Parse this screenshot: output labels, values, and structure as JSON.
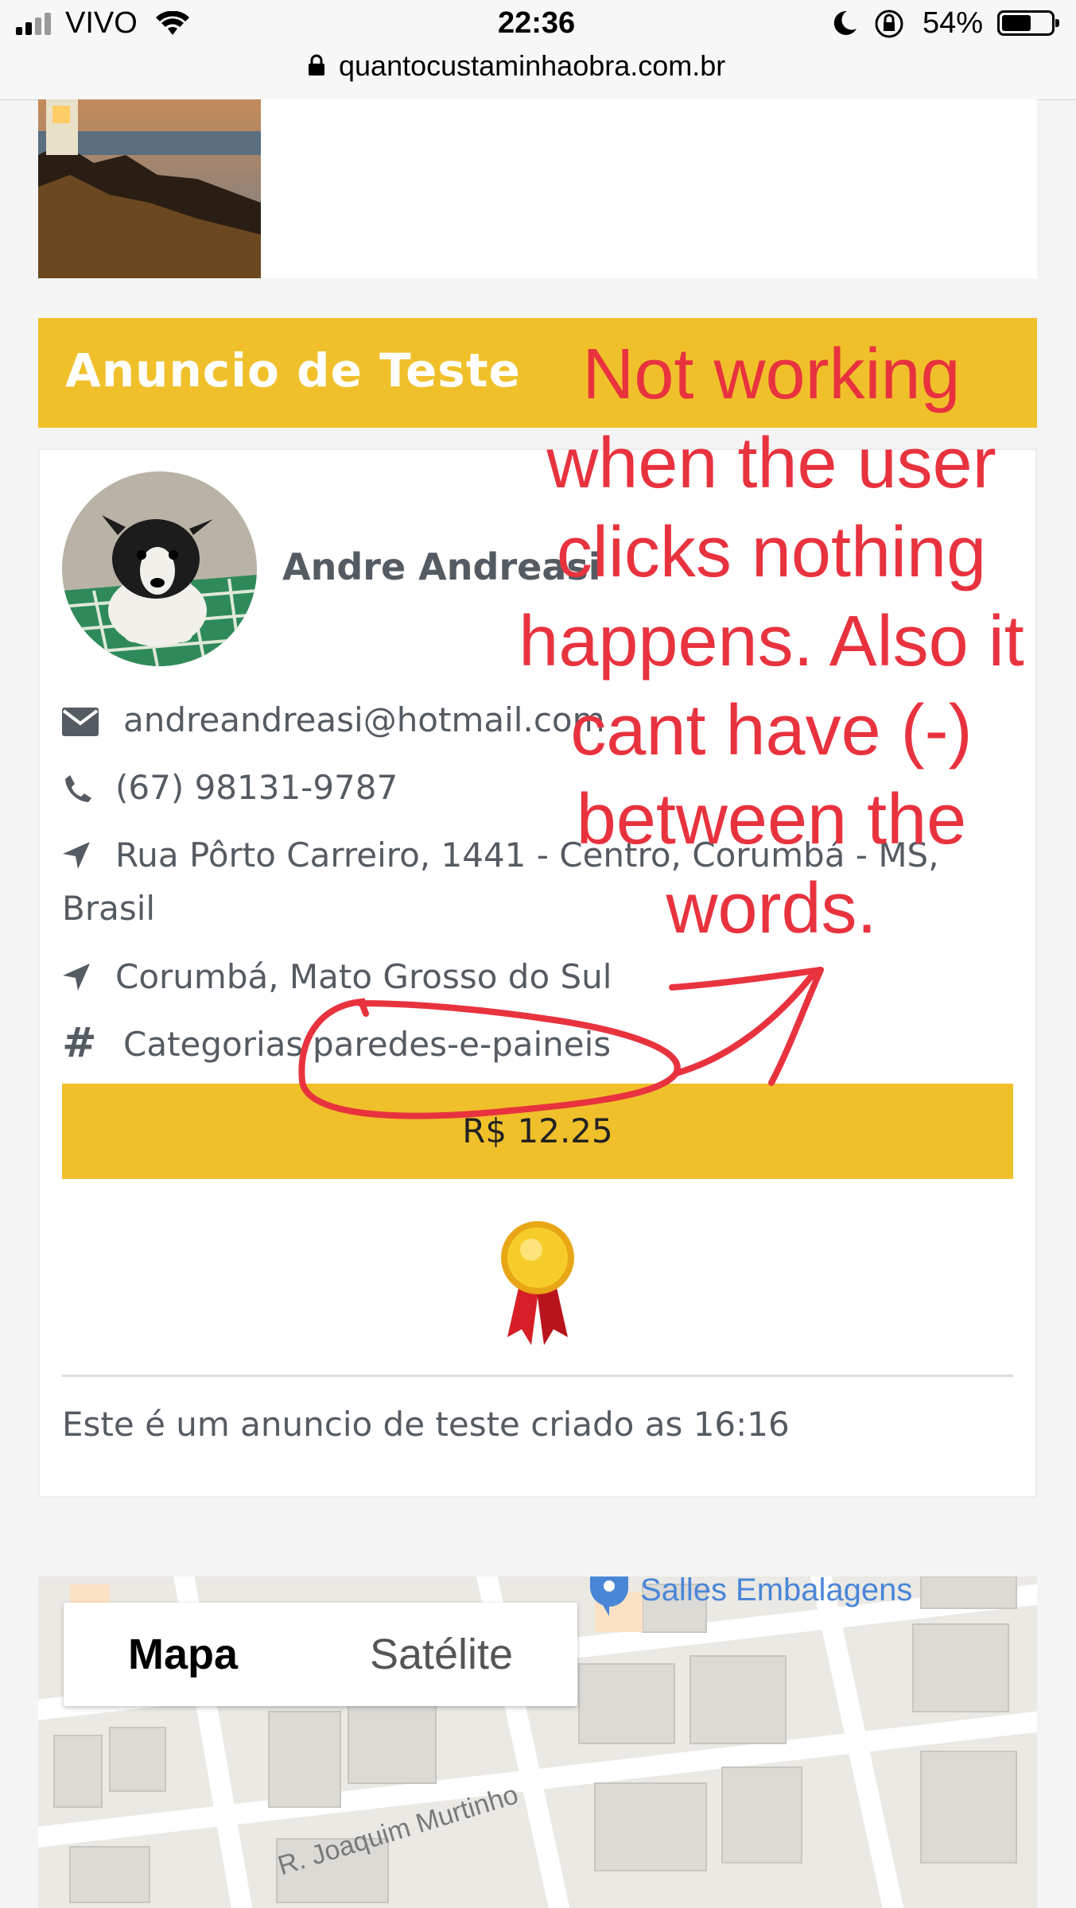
{
  "status_bar": {
    "carrier": "VIVO",
    "time": "22:36",
    "battery": "54%",
    "battery_level": 0.54,
    "url": "quantocustaminhaobra.com.br"
  },
  "listing": {
    "title": "Anuncio de Teste",
    "author": "Andre Andreasi",
    "email": "andreandreasi@hotmail.com",
    "phone": "(67) 98131-9787",
    "address_line1": "Rua Pôrto Carreiro, 1441 - Centro, Corumbá - MS,",
    "address_line2": "Brasil",
    "city": "Corumbá, Mato Grosso do Sul",
    "categories_label": "Categorias",
    "category": "paredes-e-paineis",
    "price": "R$ 12.25",
    "description": "Este é um anuncio de teste criado as 16:16"
  },
  "map": {
    "tab_map": "Mapa",
    "tab_satellite": "Satélite",
    "poi": "Salles Embalagens",
    "street": "R. Joaquim Murtinho"
  },
  "annotation": {
    "line1": "Not working",
    "line2": "when the user",
    "line3": "clicks nothing",
    "line4": "happens. Also it",
    "line5": "cant have (-)",
    "line6": "between the",
    "line7": "words.",
    "color": "#e8333f"
  },
  "icons": {
    "email": "envelope-icon",
    "phone": "phone-icon",
    "address": "location-arrow-icon",
    "city": "location-arrow-icon",
    "category": "hashtag-icon",
    "badge": "award-ribbon-icon"
  },
  "colors": {
    "accent": "#f0c02b",
    "text": "#555b63"
  }
}
